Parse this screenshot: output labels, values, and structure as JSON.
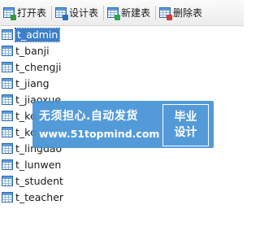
{
  "toolbar": {
    "buttons": [
      {
        "label": "打开表",
        "icon": "open-table-icon",
        "badge_color": "#3a9a3a"
      },
      {
        "label": "设计表",
        "icon": "design-table-icon",
        "badge_color": "#2a6fc4"
      },
      {
        "label": "新建表",
        "icon": "new-table-icon",
        "badge_color": "#2fa84f"
      },
      {
        "label": "删除表",
        "icon": "delete-table-icon",
        "badge_color": "#d63a2f"
      }
    ]
  },
  "tables": {
    "selected_index": 0,
    "items": [
      {
        "label": "t_admin"
      },
      {
        "label": "t_banji"
      },
      {
        "label": "t_chengji"
      },
      {
        "label": "t_jiang"
      },
      {
        "label": "t_jiaoxue"
      },
      {
        "label": "t_ke"
      },
      {
        "label": "t_ke"
      },
      {
        "label": "t_lingdao"
      },
      {
        "label": "t_lunwen"
      },
      {
        "label": "t_student"
      },
      {
        "label": "t_teacher"
      }
    ]
  },
  "banner": {
    "line1": "无须担心.自动发货",
    "line2": "www.51topmind.com",
    "box_line1": "毕业",
    "box_line2": "设计"
  },
  "colors": {
    "selection": "#3c80c9",
    "banner": "#4692d6"
  }
}
